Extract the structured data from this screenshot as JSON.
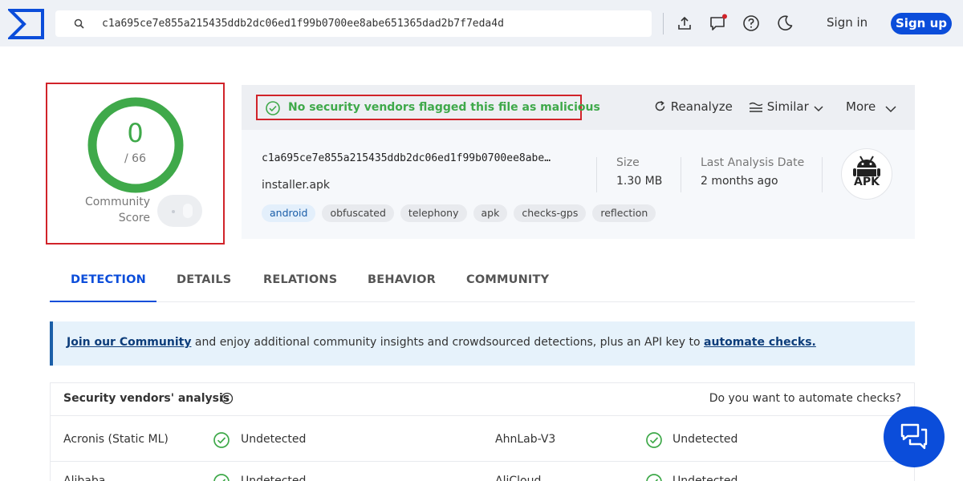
{
  "topbar": {
    "search_value": "c1a695ce7e855a215435ddb2dc06ed1f99b0700ee8abe651365dad2b7f7eda4d",
    "icons": [
      "upload-icon",
      "chat-notification-icon",
      "help-icon",
      "dark-mode-icon"
    ],
    "signin_label": "Sign in",
    "signup_label": "Sign up"
  },
  "score": {
    "detections": "0",
    "total": "/ 66",
    "community_label_1": "Community",
    "community_label_2": "Score"
  },
  "result": {
    "verdict": "No security vendors flagged this file as malicious",
    "actions": {
      "reanalyze": "Reanalyze",
      "similar": "Similar",
      "more": "More"
    },
    "hash_display": "c1a695ce7e855a215435ddb2dc06ed1f99b0700ee8abe…",
    "filename": "installer.apk",
    "tags": [
      "android",
      "obfuscated",
      "telephony",
      "apk",
      "checks-gps",
      "reflection"
    ],
    "size_label": "Size",
    "size_value": "1.30 MB",
    "date_label": "Last Analysis Date",
    "date_value": "2 months ago",
    "filetype": "APK"
  },
  "tabs": [
    "DETECTION",
    "DETAILS",
    "RELATIONS",
    "BEHAVIOR",
    "COMMUNITY"
  ],
  "active_tab": "DETECTION",
  "banner": {
    "link1": "Join our Community",
    "middle": " and enjoy additional community insights and crowdsourced detections, plus an API key to ",
    "link2": "automate checks."
  },
  "vendors": {
    "title": "Security vendors' analysis",
    "automate": "Do you want to automate checks?",
    "rows": [
      {
        "left_name": "Acronis (Static ML)",
        "left_result": "Undetected",
        "right_name": "AhnLab-V3",
        "right_result": "Undetected"
      },
      {
        "left_name": "Alibaba",
        "left_result": "Undetected",
        "right_name": "AliCloud",
        "right_result": "Undetected"
      }
    ]
  },
  "colors": {
    "brand_blue": "#0b4dda",
    "clean_green": "#3fa94a",
    "highlight_red": "#d1232a"
  }
}
